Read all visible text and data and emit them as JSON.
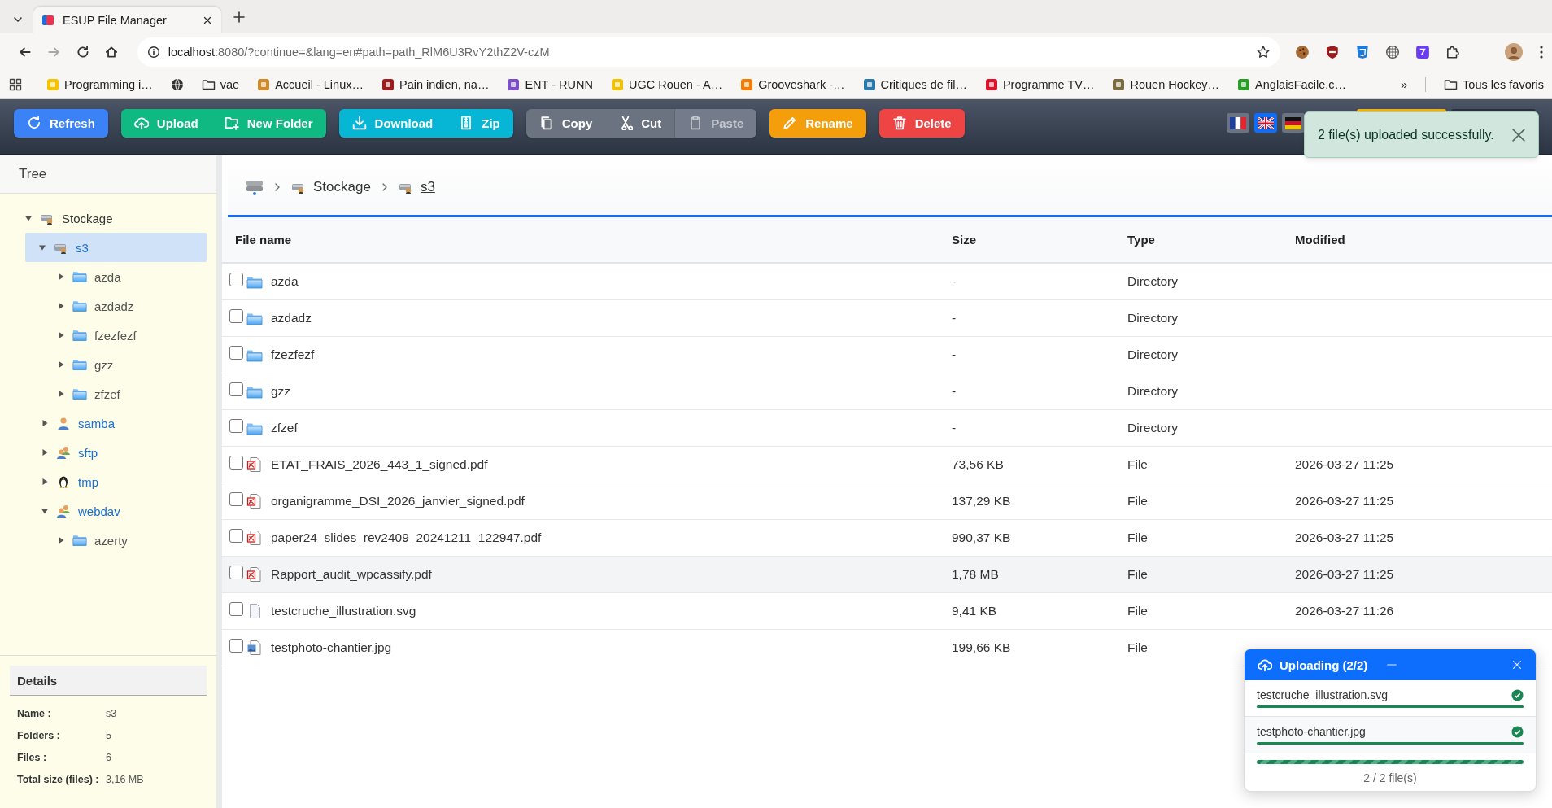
{
  "browser": {
    "tabs": [
      {
        "title": "ESUP File Manager",
        "selected": true
      }
    ],
    "nav": [
      {
        "kind": "back",
        "disabled": false
      },
      {
        "kind": "forward",
        "disabled": true
      },
      {
        "kind": "reload",
        "disabled": false
      },
      {
        "kind": "home",
        "disabled": false
      }
    ],
    "address": {
      "host": "localhost",
      "rest": ":8080/?continue=&lang=en#path=path_RlM6U3RvY2thZ2V-czM"
    },
    "bookmarks": [
      {
        "kind": "site",
        "label": "Programming i…",
        "color": "#f5c400"
      },
      {
        "kind": "globe"
      },
      {
        "kind": "folder",
        "label": "vae"
      },
      {
        "kind": "site",
        "label": "Accueil - Linux…",
        "color": "#d08a2a"
      },
      {
        "kind": "site",
        "label": "Pain indien, na…",
        "color": "#9b1c1c"
      },
      {
        "kind": "site",
        "label": "ENT - RUNN",
        "color": "#7b4fc9"
      },
      {
        "kind": "site",
        "label": "UGC Rouen - A…",
        "color": "#f2c200"
      },
      {
        "kind": "site",
        "label": "Grooveshark -…",
        "color": "#f57c00"
      },
      {
        "kind": "site",
        "label": "Critiques de fil…",
        "color": "#2a7ab0"
      },
      {
        "kind": "site",
        "label": "Programme TV…",
        "color": "#e0102a"
      },
      {
        "kind": "site",
        "label": "Rouen Hockey…",
        "color": "#7a6a40"
      },
      {
        "kind": "site",
        "label": "AnglaisFacile.c…",
        "color": "#2a9d2a"
      }
    ],
    "overflow": "»",
    "all_bookmarks": "Tous les favoris"
  },
  "toolbar": {
    "groups": [
      {
        "color": "#3b82f6",
        "buttons": [
          {
            "label": "Refresh",
            "kind": "refresh",
            "disabled": false
          }
        ]
      },
      {
        "color": "#10b981",
        "buttons": [
          {
            "label": "Upload",
            "kind": "upload",
            "disabled": false
          },
          {
            "label": "New Folder",
            "kind": "new-folder",
            "disabled": false
          }
        ]
      },
      {
        "color": "#06b6d4",
        "buttons": [
          {
            "label": "Download",
            "kind": "download",
            "disabled": false
          },
          {
            "label": "Zip",
            "kind": "zip",
            "disabled": false
          }
        ]
      },
      {
        "color": "#6b7280",
        "buttons": [
          {
            "label": "Copy",
            "kind": "copy",
            "disabled": false
          },
          {
            "label": "Cut",
            "kind": "cut",
            "disabled": false
          },
          {
            "label": "Paste",
            "kind": "paste",
            "disabled": true
          }
        ]
      },
      {
        "color": "#f59e0b",
        "buttons": [
          {
            "label": "Rename",
            "kind": "rename",
            "disabled": false
          }
        ]
      },
      {
        "color": "#ef4444",
        "buttons": [
          {
            "label": "Delete",
            "kind": "delete",
            "disabled": false
          }
        ]
      }
    ],
    "languages": [
      {
        "kind": "fr",
        "selected": false
      },
      {
        "kind": "gb",
        "selected": true
      },
      {
        "kind": "de",
        "selected": false
      }
    ],
    "covered_buttons": [
      {
        "color": "#f5b40b"
      },
      {
        "color": "#2a313c"
      }
    ]
  },
  "sidebar": {
    "title": "Tree",
    "tree": [
      {
        "label": "Stockage",
        "kind": "root",
        "expanded": true,
        "selected": false,
        "children": [
          {
            "label": "s3",
            "kind": "storage",
            "expanded": true,
            "selected": true,
            "children": [
              {
                "label": "azda",
                "kind": "folder",
                "expanded": false,
                "selected": false
              },
              {
                "label": "azdadz",
                "kind": "folder",
                "expanded": false,
                "selected": false
              },
              {
                "label": "fzezfezf",
                "kind": "folder",
                "expanded": false,
                "selected": false
              },
              {
                "label": "gzz",
                "kind": "folder",
                "expanded": false,
                "selected": false
              },
              {
                "label": "zfzef",
                "kind": "folder",
                "expanded": false,
                "selected": false
              }
            ]
          },
          {
            "label": "samba",
            "kind": "user",
            "expanded": false,
            "selected": false
          },
          {
            "label": "sftp",
            "kind": "users",
            "expanded": false,
            "selected": false
          },
          {
            "label": "tmp",
            "kind": "linux",
            "expanded": false,
            "selected": false
          },
          {
            "label": "webdav",
            "kind": "users",
            "expanded": true,
            "selected": false,
            "children": [
              {
                "label": "azerty",
                "kind": "folder",
                "expanded": false,
                "selected": false
              }
            ]
          }
        ]
      }
    ],
    "details": {
      "title": "Details",
      "rows": [
        {
          "label": "Name :",
          "value": "s3"
        },
        {
          "label": "Folders :",
          "value": "5"
        },
        {
          "label": "Files :",
          "value": "6"
        },
        {
          "label": "Total size (files) :",
          "value": "3,16 MB"
        }
      ]
    }
  },
  "main": {
    "breadcrumb": [
      {
        "kind": "root"
      },
      {
        "kind": "storage",
        "label": "Stockage",
        "current": false
      },
      {
        "kind": "storage",
        "label": "s3",
        "current": true
      }
    ],
    "table": {
      "columns": [
        "File name",
        "Size",
        "Type",
        "Modified"
      ],
      "rows": [
        {
          "kind": "folder",
          "name": "azda",
          "size": "-",
          "type": "Directory",
          "checked": false,
          "hovered": false
        },
        {
          "kind": "folder",
          "name": "azdadz",
          "size": "-",
          "type": "Directory",
          "checked": false,
          "hovered": false
        },
        {
          "kind": "folder",
          "name": "fzezfezf",
          "size": "-",
          "type": "Directory",
          "checked": false,
          "hovered": false
        },
        {
          "kind": "folder",
          "name": "gzz",
          "size": "-",
          "type": "Directory",
          "checked": false,
          "hovered": false
        },
        {
          "kind": "folder",
          "name": "zfzef",
          "size": "-",
          "type": "Directory",
          "checked": false,
          "hovered": false
        },
        {
          "kind": "pdf",
          "name": "ETAT_FRAIS_2026_443_1_signed.pdf",
          "size": "73,56 KB",
          "type": "File",
          "modified": "2026-03-27 11:25",
          "checked": false,
          "hovered": false
        },
        {
          "kind": "pdf",
          "name": "organigramme_DSI_2026_janvier_signed.pdf",
          "size": "137,29 KB",
          "type": "File",
          "modified": "2026-03-27 11:25",
          "checked": false,
          "hovered": false
        },
        {
          "kind": "pdf",
          "name": "paper24_slides_rev2409_20241211_122947.pdf",
          "size": "990,37 KB",
          "type": "File",
          "modified": "2026-03-27 11:25",
          "checked": false,
          "hovered": false
        },
        {
          "kind": "pdf",
          "name": "Rapport_audit_wpcassify.pdf",
          "size": "1,78 MB",
          "type": "File",
          "modified": "2026-03-27 11:25",
          "checked": false,
          "hovered": true
        },
        {
          "kind": "file",
          "name": "testcruche_illustration.svg",
          "size": "9,41 KB",
          "type": "File",
          "modified": "2026-03-27 11:26",
          "checked": false,
          "hovered": false
        },
        {
          "kind": "image",
          "name": "testphoto-chantier.jpg",
          "size": "199,66 KB",
          "type": "File",
          "checked": false,
          "hovered": false
        }
      ]
    }
  },
  "upload": {
    "title": "Uploading (2/2)",
    "files": [
      {
        "name": "testcruche_illustration.svg",
        "level": 1,
        "done": true
      },
      {
        "name": "testphoto-chantier.jpg",
        "level": 1,
        "done": true
      }
    ],
    "total": {
      "level": 1,
      "label": "2 / 2 file(s)"
    }
  },
  "toast": {
    "message": "2 file(s) uploaded successfully."
  }
}
